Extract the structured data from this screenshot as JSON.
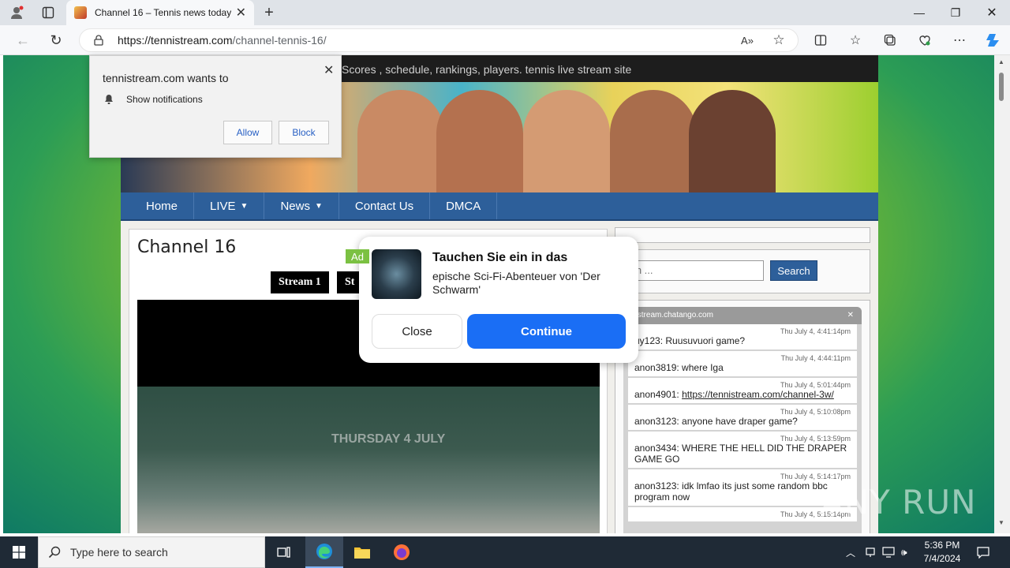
{
  "browser": {
    "tab_title": "Channel 16 – Tennis news today,",
    "url_domain": "https://tennistream.com",
    "url_path": "/channel-tennis-16/"
  },
  "site": {
    "tagline": "Scores , schedule, rankings, players. tennis live stream site",
    "nav": [
      "Home",
      "LIVE",
      "News",
      "Contact Us",
      "DMCA"
    ],
    "page_title": "Channel 16",
    "stream_buttons": [
      "Stream 1",
      "St"
    ],
    "video_caption": "THURSDAY 4 JULY",
    "search_placeholder": "rch ...",
    "search_button": "Search",
    "chat_header": "nistream.chatango.com",
    "chat": [
      {
        "time": "Thu July 4, 4:41:14pm",
        "text": "uy123: Ruusuvuori game?"
      },
      {
        "time": "Thu July 4, 4:44:11pm",
        "text": "anon3819: where Iga"
      },
      {
        "time": "Thu July 4, 5:01:44pm",
        "text": "anon4901: ",
        "link": "https://tennistream.com/channel-3w/"
      },
      {
        "time": "Thu July 4, 5:10:08pm",
        "text": "anon3123: anyone have draper game?"
      },
      {
        "time": "Thu July 4, 5:13:59pm",
        "text": "anon3434: WHERE THE HELL DID THE DRAPER GAME GO"
      },
      {
        "time": "Thu July 4, 5:14:17pm",
        "text": "anon3123: idk lmfao its just some random bbc program now"
      },
      {
        "time": "Thu July 4, 5:15:14pm",
        "text": ""
      }
    ]
  },
  "notification": {
    "title": "tennistream.com wants to",
    "desc": "Show notifications",
    "allow": "Allow",
    "block": "Block"
  },
  "ad": {
    "tag": "Ad",
    "headline": "Tauchen Sie ein in das",
    "body": "epische Sci-Fi-Abenteuer von 'Der Schwarm'",
    "close": "Close",
    "continue": "Continue"
  },
  "watermark": "ANY RUN",
  "taskbar": {
    "search_placeholder": "Type here to search",
    "time": "5:36 PM",
    "date": "7/4/2024"
  }
}
